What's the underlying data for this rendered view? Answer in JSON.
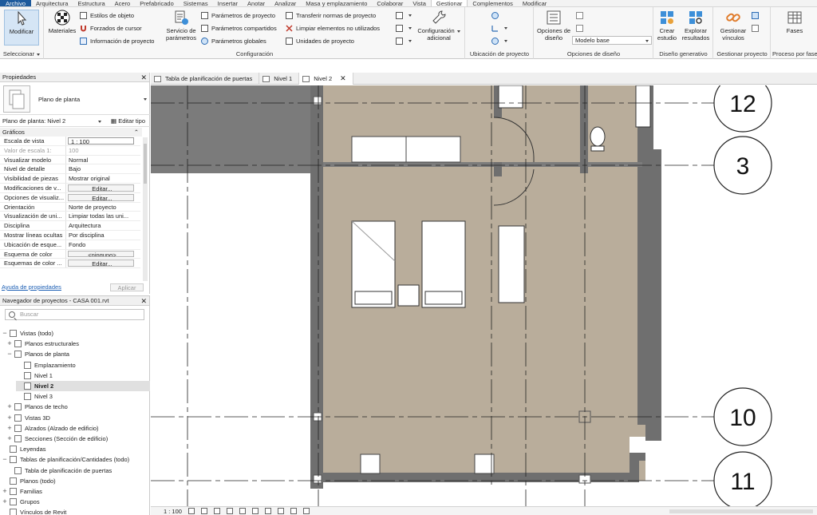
{
  "menu": {
    "tabs": [
      "Archivo",
      "Arquitectura",
      "Estructura",
      "Acero",
      "Prefabricado",
      "Sistemas",
      "Insertar",
      "Anotar",
      "Analizar",
      "Masa y emplazamiento",
      "Colaborar",
      "Vista",
      "Gestionar",
      "Complementos",
      "Modificar"
    ],
    "active": "Gestionar"
  },
  "ribbon": {
    "modify": "Modificar",
    "select_panel": "Seleccionar",
    "materials": "Materiales",
    "object_styles": "Estilos de objeto",
    "snaps": "Forzados de cursor",
    "project_info": "Información de proyecto",
    "services_l1": "Servicio de",
    "services_l2": "parámetros",
    "project_params": "Parámetros de proyecto",
    "shared_params": "Parámetros compartidos",
    "global_params": "Parámetros globales",
    "transfer": "Transferir normas de proyecto",
    "purge": "Limpiar elementos no utilizados",
    "units": "Unidades de proyecto",
    "add_settings_l1": "Configuración",
    "add_settings_l2": "adicional",
    "config_panel": "Configuración",
    "location_panel": "Ubicación de proyecto",
    "design_options_l1": "Opciones de",
    "design_options_l2": "diseño",
    "main_model": "Modelo base",
    "design_options_panel": "Opciones de diseño",
    "create_study_l1": "Crear",
    "create_study_l2": "estudio",
    "explore_l1": "Explorar",
    "explore_l2": "resultados",
    "gen_design_panel": "Diseño generativo",
    "manage_links_l1": "Gestionar",
    "manage_links_l2": "vínculos",
    "manage_project_panel": "Gestionar proyecto",
    "phases": "Fases",
    "phasing_panel": "Proceso por fase"
  },
  "properties": {
    "title": "Propiedades",
    "type_name": "Plano de planta",
    "instance": "Plano de planta: Nivel 2",
    "edit_type": "Editar tipo",
    "group": "Gráficos",
    "rows": [
      {
        "name": "Escala de vista",
        "value": "1 : 100"
      },
      {
        "name": "Valor de escala",
        "value": "100"
      },
      {
        "name": "Visualizar modelo",
        "value": "Normal"
      },
      {
        "name": "Nivel de detalle",
        "value": "Bajo"
      },
      {
        "name": "Visibilidad de piezas",
        "value": "Mostrar original"
      },
      {
        "name": "Modificaciones de v...",
        "value": "Editar..."
      },
      {
        "name": "Opciones de visualiz...",
        "value": "Editar..."
      },
      {
        "name": "Orientación",
        "value": "Norte de proyecto"
      },
      {
        "name": "Visualización de uni...",
        "value": "Limpiar todas las uni..."
      },
      {
        "name": "Disciplina",
        "value": "Arquitectura"
      },
      {
        "name": "Mostrar líneas ocultas",
        "value": "Por disciplina"
      },
      {
        "name": "Ubicación de esque...",
        "value": "Fondo"
      },
      {
        "name": "Esquema de color",
        "value": "<ninguno>"
      },
      {
        "name": "Esquemas de color ...",
        "value": "Editar..."
      }
    ],
    "help": "Ayuda de propiedades",
    "apply": "Aplicar"
  },
  "browser": {
    "title": "Navegador de proyectos - CASA 001.rvt",
    "search_placeholder": "Buscar",
    "items": [
      {
        "label": "Vistas (todo)",
        "toggle": "−"
      },
      {
        "label": "Planos estructurales",
        "toggle": "+"
      },
      {
        "label": "Planos de planta",
        "toggle": "−"
      },
      {
        "label": "Emplazamiento",
        "toggle": ""
      },
      {
        "label": "Nivel 1",
        "toggle": ""
      },
      {
        "label": "Nivel 2",
        "toggle": ""
      },
      {
        "label": "Nivel 3",
        "toggle": ""
      },
      {
        "label": "Planos de techo",
        "toggle": "+"
      },
      {
        "label": "Vistas 3D",
        "toggle": "+"
      },
      {
        "label": "Alzados (Alzado de edificio)",
        "toggle": "+"
      },
      {
        "label": "Secciones (Sección de edificio)",
        "toggle": "+"
      },
      {
        "label": "Leyendas",
        "toggle": ""
      },
      {
        "label": "Tablas de planificación/Cantidades (todo)",
        "toggle": "−"
      },
      {
        "label": "Tabla de planificación de puertas",
        "toggle": ""
      },
      {
        "label": "Planos (todo)",
        "toggle": ""
      },
      {
        "label": "Familias",
        "toggle": "+"
      },
      {
        "label": "Grupos",
        "toggle": "+"
      },
      {
        "label": "Vínculos de Revit",
        "toggle": ""
      }
    ]
  },
  "view_tabs": [
    "Tabla de planificación de puertas",
    "Nivel 1",
    "Nivel 2"
  ],
  "grids": [
    "12",
    "3",
    "10",
    "11"
  ],
  "status": {
    "scale": "1 : 100"
  },
  "colors": {
    "file_tab": "#1d5a9c",
    "floor": "#b9ad9b",
    "wall": "#6f6f6f",
    "link": "#1d5fb4"
  }
}
